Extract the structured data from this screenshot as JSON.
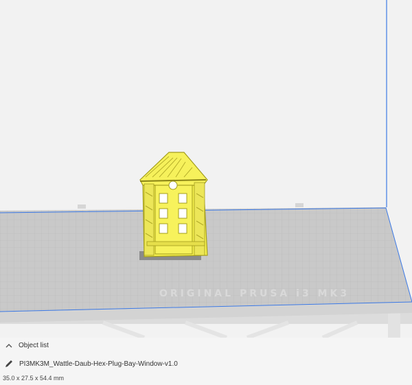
{
  "viewport": {
    "bed_logo_text": "ORIGINAL PRUSA i3 MK3",
    "colors": {
      "background": "#f2f2f2",
      "bed": "#c8c8c8",
      "grid": "#b7b7b7",
      "volume_line": "#3b79e6",
      "model": "#f7f35a",
      "model_edge": "#a8a21f"
    }
  },
  "object_list": {
    "label": "Object list",
    "toggle_icon": "chevron-up-icon",
    "selected_file": "PI3MK3M_Wattle-Daub-Hex-Plug-Bay-Window-v1.0",
    "edit_icon": "pencil-icon",
    "dimensions": "35.0 x 27.5 x 54.4 mm"
  }
}
